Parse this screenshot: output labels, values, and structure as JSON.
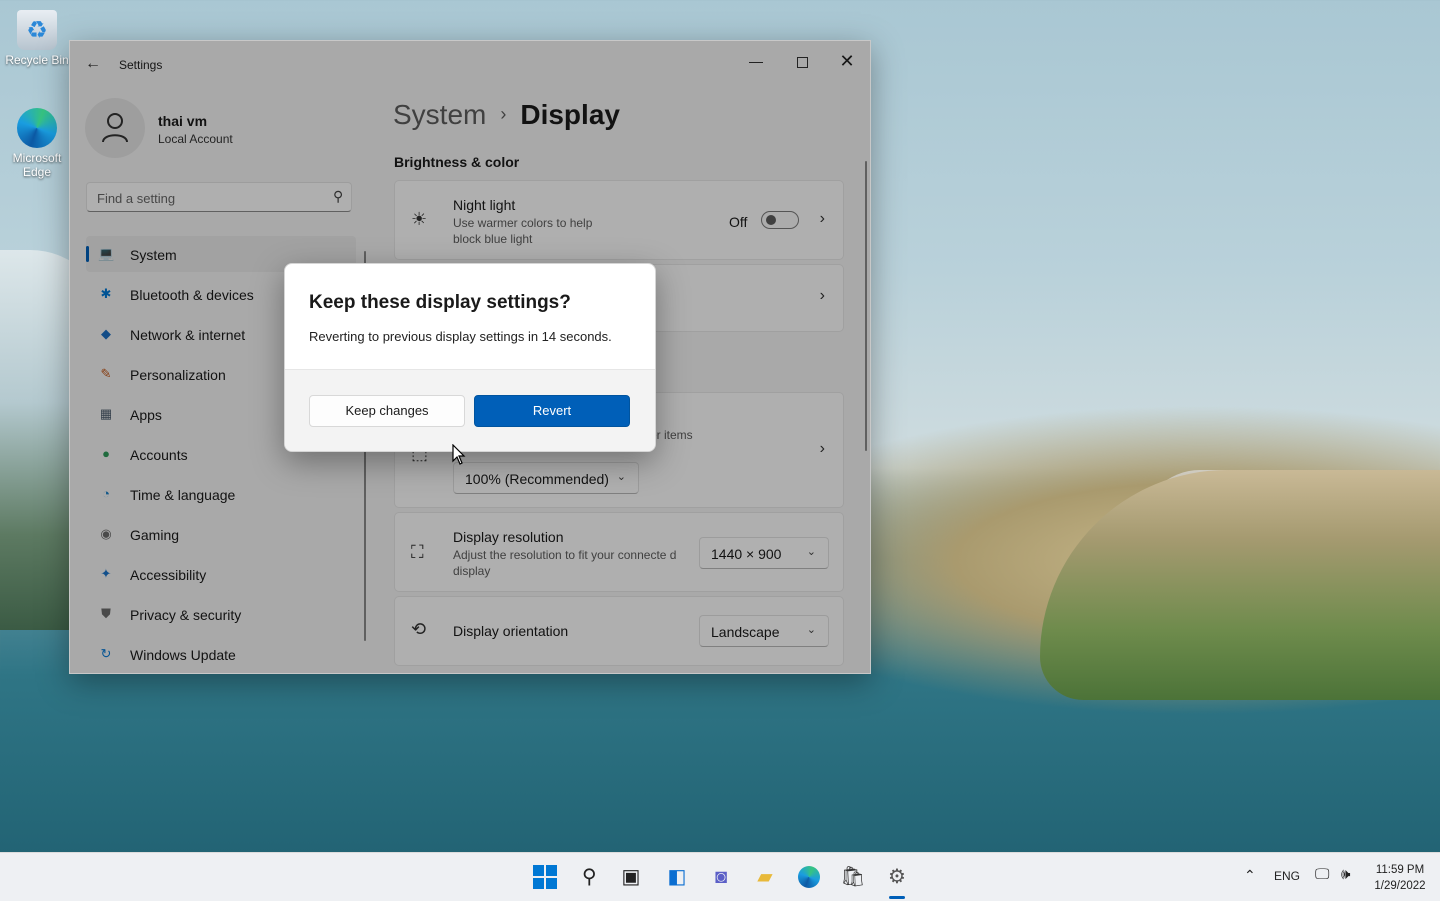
{
  "desktop": {
    "icons": [
      {
        "label": "Recycle Bin"
      },
      {
        "label": "Microsoft Edge"
      }
    ]
  },
  "window": {
    "title": "Settings",
    "controls": {
      "minimize": "—",
      "close": "✕"
    }
  },
  "user": {
    "name": "thai vm",
    "account_type": "Local Account"
  },
  "search": {
    "placeholder": "Find a setting"
  },
  "nav": {
    "items": [
      {
        "label": "System",
        "icon": "💻",
        "color": "#0078d4"
      },
      {
        "label": "Bluetooth & devices",
        "icon": "✱",
        "color": "#0078d4"
      },
      {
        "label": "Network & internet",
        "icon": "◆",
        "color": "#1b6ec2"
      },
      {
        "label": "Personalization",
        "icon": "✎",
        "color": "#c0581b"
      },
      {
        "label": "Apps",
        "icon": "▦",
        "color": "#4a5a6a"
      },
      {
        "label": "Accounts",
        "icon": "●",
        "color": "#2e9a5a"
      },
      {
        "label": "Time & language",
        "icon": "◔",
        "color": "#1c7fc4"
      },
      {
        "label": "Gaming",
        "icon": "◉",
        "color": "#6b6b6b"
      },
      {
        "label": "Accessibility",
        "icon": "✦",
        "color": "#1a73c8"
      },
      {
        "label": "Privacy & security",
        "icon": "⛊",
        "color": "#6b6b6b"
      },
      {
        "label": "Windows Update",
        "icon": "↻",
        "color": "#0a7ad4"
      }
    ]
  },
  "breadcrumb": {
    "parent": "System",
    "separator": "›",
    "current": "Display"
  },
  "sections": {
    "brightness": "Brightness & color"
  },
  "cards": {
    "night_light": {
      "title": "Night light",
      "subtitle": "Use warmer colors to help block blue light",
      "toggle_label": "Off"
    },
    "scale": {
      "subtitle_fragment": "er items",
      "value": "100% (Recommended)"
    },
    "resolution": {
      "title": "Display resolution",
      "subtitle": "Adjust the resolution to fit your connecte d display",
      "value": "1440 × 900"
    },
    "orientation": {
      "title": "Display orientation",
      "value": "Landscape"
    }
  },
  "dialog": {
    "title": "Keep these display settings?",
    "body": "Reverting to previous display settings in 14 seconds.",
    "keep_label": "Keep changes",
    "revert_label": "Revert"
  },
  "taskbar": {
    "tray": {
      "lang": "ENG",
      "time": "11:59 PM",
      "date": "1/29/2022"
    }
  },
  "colors": {
    "accent": "#005fb8"
  }
}
